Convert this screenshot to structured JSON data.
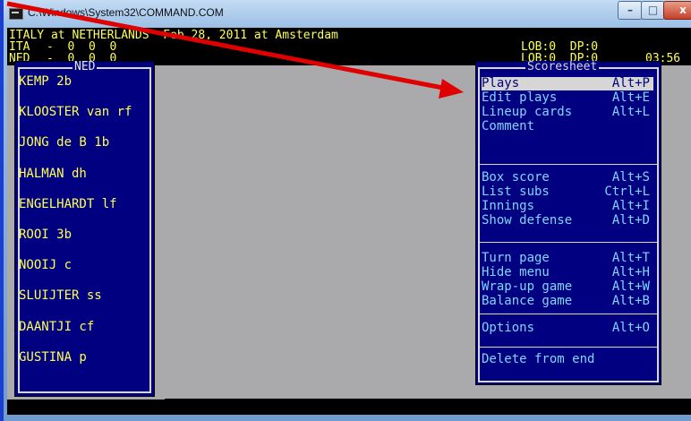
{
  "window": {
    "title": "C:\\Windows\\System32\\COMMAND.COM",
    "buttons": {
      "minimize": "–",
      "maximize": "□",
      "close": "x"
    }
  },
  "game": {
    "header": "ITALY at NETHERLANDS  Feb 28, 2011 at Amsterdam",
    "lines": [
      {
        "team": "ITA",
        "score": "-  0  0  0",
        "status": "LOB:0  DP:0",
        "time": ""
      },
      {
        "team": "NED",
        "score": "-  0  0  0",
        "status": "LOB:0  DP:0",
        "time": "03:56"
      }
    ]
  },
  "ned_panel": {
    "title": "NED",
    "players": [
      "KEMP 2b",
      "KLOOSTER van rf",
      "JONG de B 1b",
      "HALMAN dh",
      "ENGELHARDT lf",
      "ROOI 3b",
      "NOOIJ c",
      "SLUIJTER ss",
      "DAANTJI cf",
      "GUSTINA p"
    ]
  },
  "scoresheet_menu": {
    "title": "Scoresheet",
    "groups": [
      [
        {
          "label": "Plays",
          "key": "Alt+P",
          "selected": true
        },
        {
          "label": "Edit plays",
          "key": "Alt+E"
        },
        {
          "label": "Lineup cards",
          "key": "Alt+L"
        },
        {
          "label": "Comment",
          "key": ""
        }
      ],
      [
        {
          "label": "Box score",
          "key": "Alt+S"
        },
        {
          "label": "List subs",
          "key": "Ctrl+L"
        },
        {
          "label": "Innings",
          "key": "Alt+I"
        },
        {
          "label": "Show defense",
          "key": "Alt+D"
        }
      ],
      [
        {
          "label": "Turn page",
          "key": "Alt+T"
        },
        {
          "label": "Hide menu",
          "key": "Alt+H"
        },
        {
          "label": "Wrap-up game",
          "key": "Alt+W"
        },
        {
          "label": "Balance game",
          "key": "Alt+B"
        }
      ],
      [
        {
          "label": "Options",
          "key": "Alt+O"
        }
      ],
      [
        {
          "label": "Delete from end",
          "key": ""
        }
      ]
    ]
  },
  "colors": {
    "console_bg": "#000000",
    "text_yellow": "#ffff55",
    "panel_blue": "#000080",
    "menu_text": "#7fd6ff",
    "annotation_red": "#e00000"
  }
}
